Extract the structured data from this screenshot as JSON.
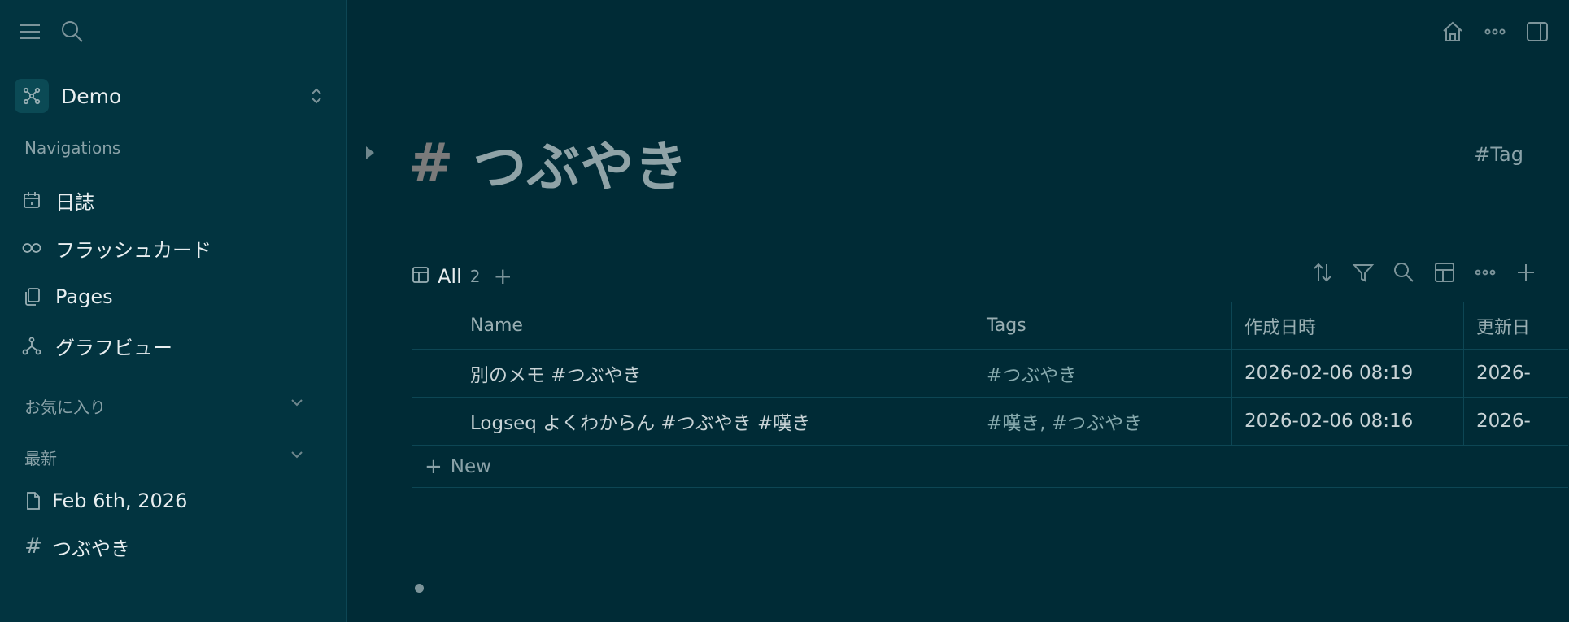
{
  "sidebar": {
    "graph_name": "Demo",
    "navigations_title": "Navigations",
    "nav_items": [
      {
        "label": "日誌",
        "icon": "calendar-icon"
      },
      {
        "label": "フラッシュカード",
        "icon": "infinity-icon"
      },
      {
        "label": "Pages",
        "icon": "pages-icon"
      },
      {
        "label": "グラフビュー",
        "icon": "graph-icon"
      }
    ],
    "favorites_title": "お気に入り",
    "recent_title": "最新",
    "recent_items": [
      {
        "label": "Feb 6th, 2026",
        "icon": "file-icon"
      },
      {
        "label": "つぶやき",
        "icon": "hash-icon"
      }
    ]
  },
  "page": {
    "hash": "#",
    "title": "つぶやき",
    "tag": "#Tag"
  },
  "view": {
    "name": "All",
    "count": "2",
    "add": "+"
  },
  "table": {
    "headers": {
      "name": "Name",
      "tags": "Tags",
      "created": "作成日時",
      "updated": "更新日"
    },
    "rows": [
      {
        "name": "別のメモ #つぶやき",
        "tags": "#つぶやき",
        "created": "2026-02-06 08:19",
        "updated": "2026-"
      },
      {
        "name": "Logseq よくわからん #つぶやき #嘆き",
        "tags": "#嘆き, #つぶやき",
        "created": "2026-02-06 08:16",
        "updated": "2026-"
      }
    ],
    "new_label": "New"
  },
  "colors": {
    "background": "#002b36",
    "sidebar": "#023440",
    "border": "#0d4654"
  }
}
